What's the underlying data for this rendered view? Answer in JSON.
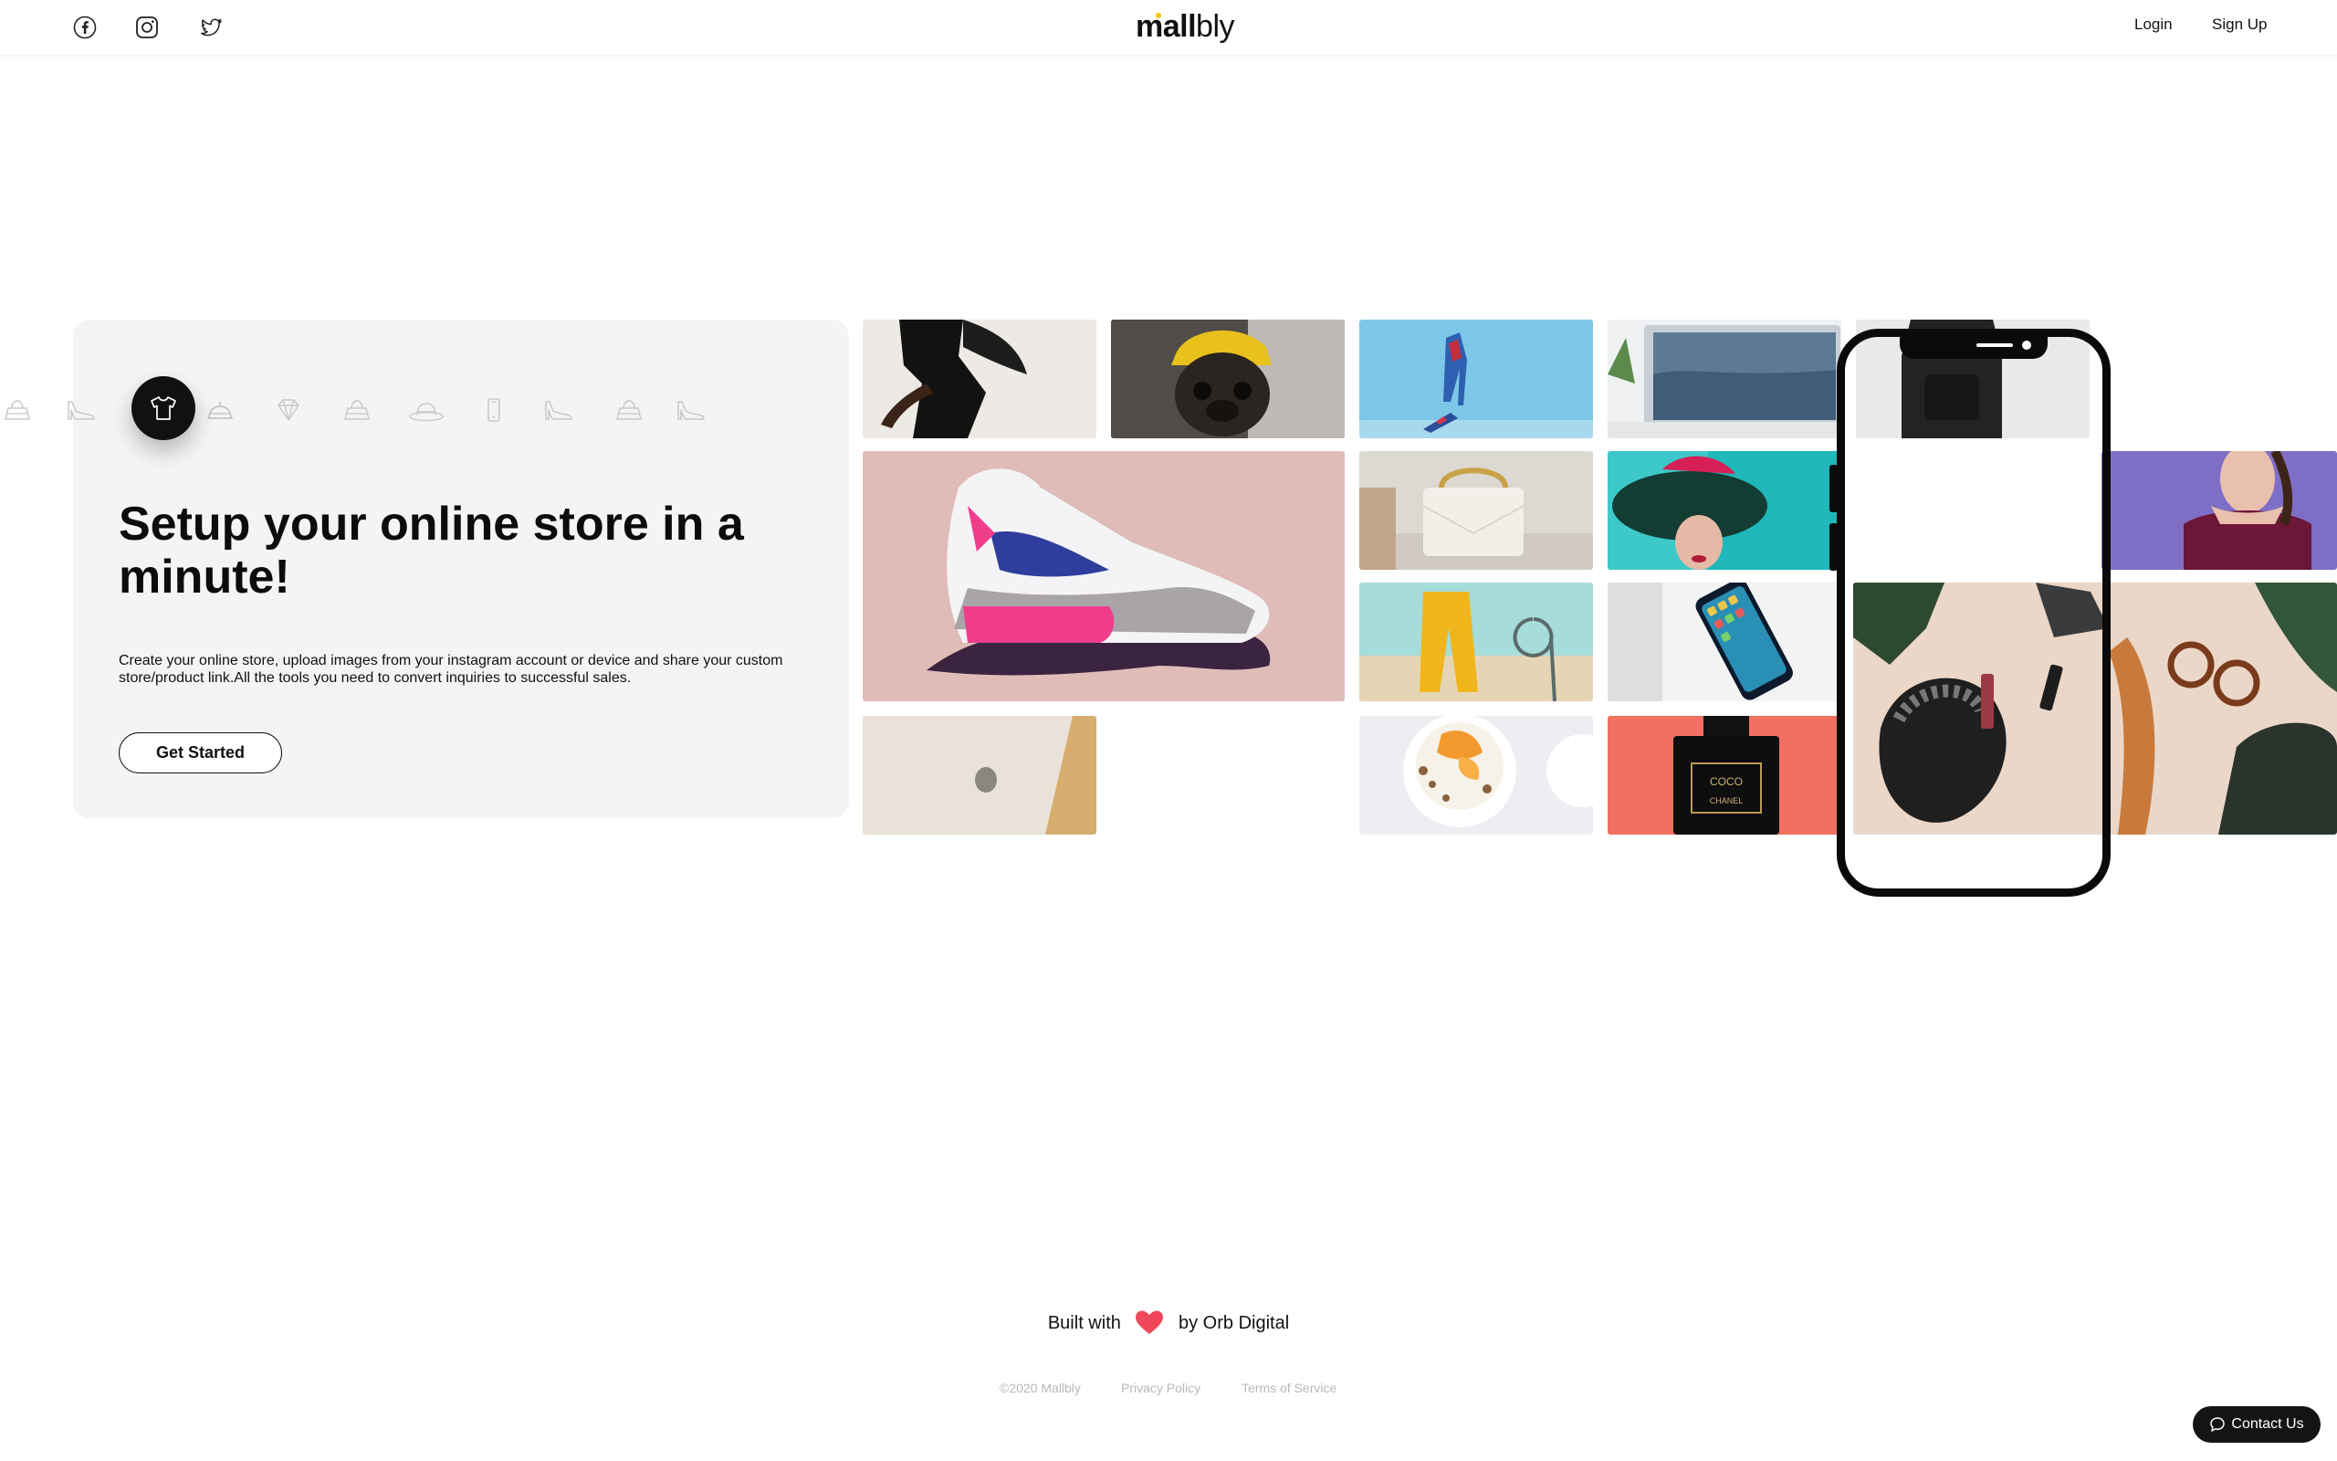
{
  "header": {
    "social": [
      {
        "name": "facebook-icon"
      },
      {
        "name": "instagram-icon"
      },
      {
        "name": "twitter-icon"
      }
    ],
    "logo_bold": "mall",
    "logo_light": "bly",
    "login_label": "Login",
    "signup_label": "Sign Up"
  },
  "hero": {
    "title": "Setup your online store in a minute!",
    "description": "Create your online store, upload images from your instagram account or device and share your custom store/product link.All the tools you need to convert inquiries to successful sales.",
    "cta_label": "Get Started",
    "category_icons": [
      "handbag-icon",
      "heel-shoe-icon",
      "tshirt-icon",
      "cake-icon",
      "diamond-icon",
      "handbag-icon",
      "hat-icon",
      "phone-icon",
      "heel-shoe-icon",
      "handbag-icon",
      "heel-shoe-icon"
    ],
    "active_category": "tshirt-icon"
  },
  "footer": {
    "built_prefix": "Built with",
    "built_suffix": "by Orb Digital",
    "copyright": "©2020 Mallbly",
    "privacy": "Privacy Policy",
    "terms": "Terms of Service",
    "contact_label": "Contact Us"
  },
  "colors": {
    "accent_dot": "#f5c400",
    "heart": "#f0485a",
    "dark": "#111111"
  }
}
